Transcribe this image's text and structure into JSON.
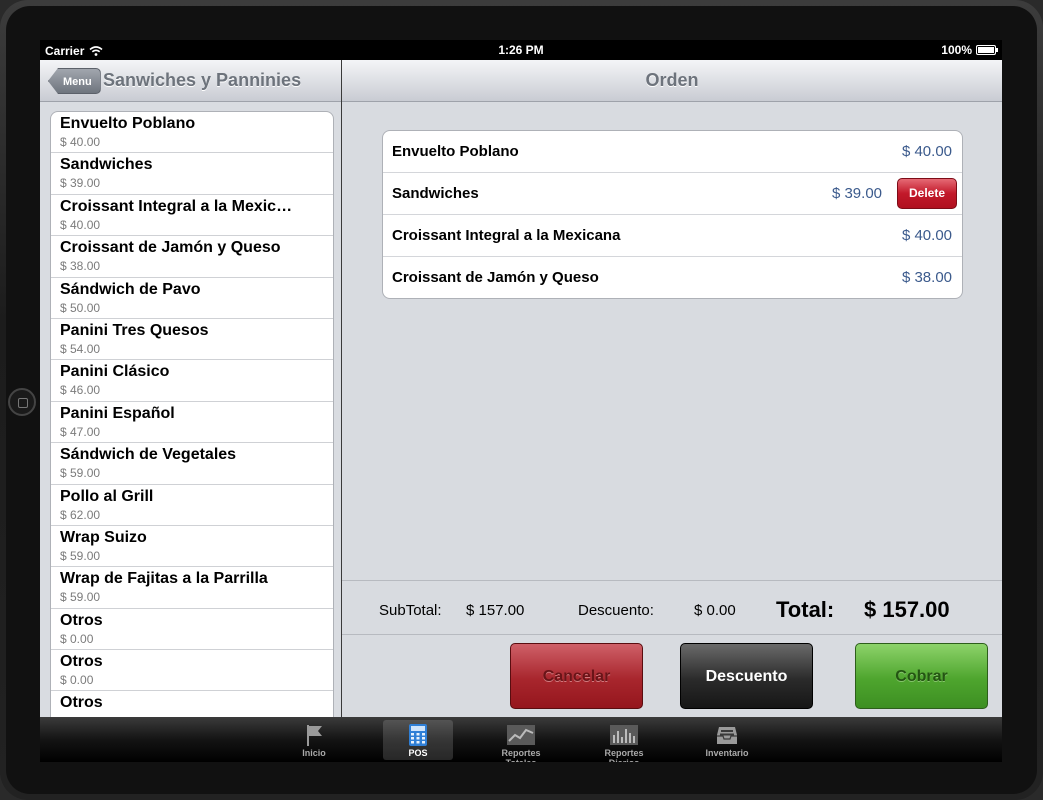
{
  "status_bar": {
    "carrier": "Carrier",
    "time": "1:26 PM",
    "battery": "100%"
  },
  "left_pane": {
    "back_label": "Menu",
    "title": "Sanwiches y Panninies",
    "items": [
      {
        "name": "Envuelto Poblano",
        "price": "$ 40.00"
      },
      {
        "name": "Sandwiches",
        "price": "$ 39.00"
      },
      {
        "name": "Croissant  Integral a la Mexic…",
        "price": "$ 40.00"
      },
      {
        "name": "Croissant de Jamón y Queso",
        "price": "$ 38.00"
      },
      {
        "name": "Sándwich de Pavo",
        "price": "$ 50.00"
      },
      {
        "name": "Panini Tres Quesos",
        "price": "$ 54.00"
      },
      {
        "name": "Panini Clásico",
        "price": "$ 46.00"
      },
      {
        "name": "Panini Español",
        "price": "$ 47.00"
      },
      {
        "name": "Sándwich de Vegetales",
        "price": "$ 59.00"
      },
      {
        "name": "Pollo al Grill",
        "price": "$ 62.00"
      },
      {
        "name": "Wrap Suizo",
        "price": "$ 59.00"
      },
      {
        "name": "Wrap de Fajitas a la Parrilla",
        "price": "$ 59.00"
      },
      {
        "name": "Otros",
        "price": "$ 0.00"
      },
      {
        "name": "Otros",
        "price": "$ 0.00"
      },
      {
        "name": "Otros",
        "price": ""
      }
    ]
  },
  "right_pane": {
    "title": "Orden",
    "order": [
      {
        "name": "Envuelto Poblano",
        "price": "$ 40.00"
      },
      {
        "name": "Sandwiches",
        "price": "$ 39.00",
        "delete_label": "Delete"
      },
      {
        "name": "Croissant  Integral a la Mexicana",
        "price": "$ 40.00"
      },
      {
        "name": "Croissant de Jamón y Queso",
        "price": "$ 38.00"
      }
    ],
    "totals": {
      "subtotal_label": "SubTotal:",
      "subtotal_value": "$ 157.00",
      "discount_label": "Descuento:",
      "discount_value": "$ 0.00",
      "total_label": "Total:",
      "total_value": "$ 157.00"
    },
    "buttons": {
      "cancel": "Cancelar",
      "discount": "Descuento",
      "charge": "Cobrar"
    }
  },
  "tab_bar": {
    "tabs": [
      {
        "label": "Inicio",
        "icon": "flag-icon"
      },
      {
        "label": "POS",
        "icon": "calculator-icon"
      },
      {
        "label": "Reportes Totales",
        "icon": "line-chart-icon"
      },
      {
        "label": "Reportes Diarios",
        "icon": "bar-chart-icon"
      },
      {
        "label": "Inventario",
        "icon": "inbox-icon"
      }
    ],
    "active": "POS"
  },
  "colors": {
    "price_blue": "#3b5a8c",
    "delete_red": "#c2192a",
    "cancel_red": "#a8262d",
    "charge_green": "#4ea52e"
  }
}
